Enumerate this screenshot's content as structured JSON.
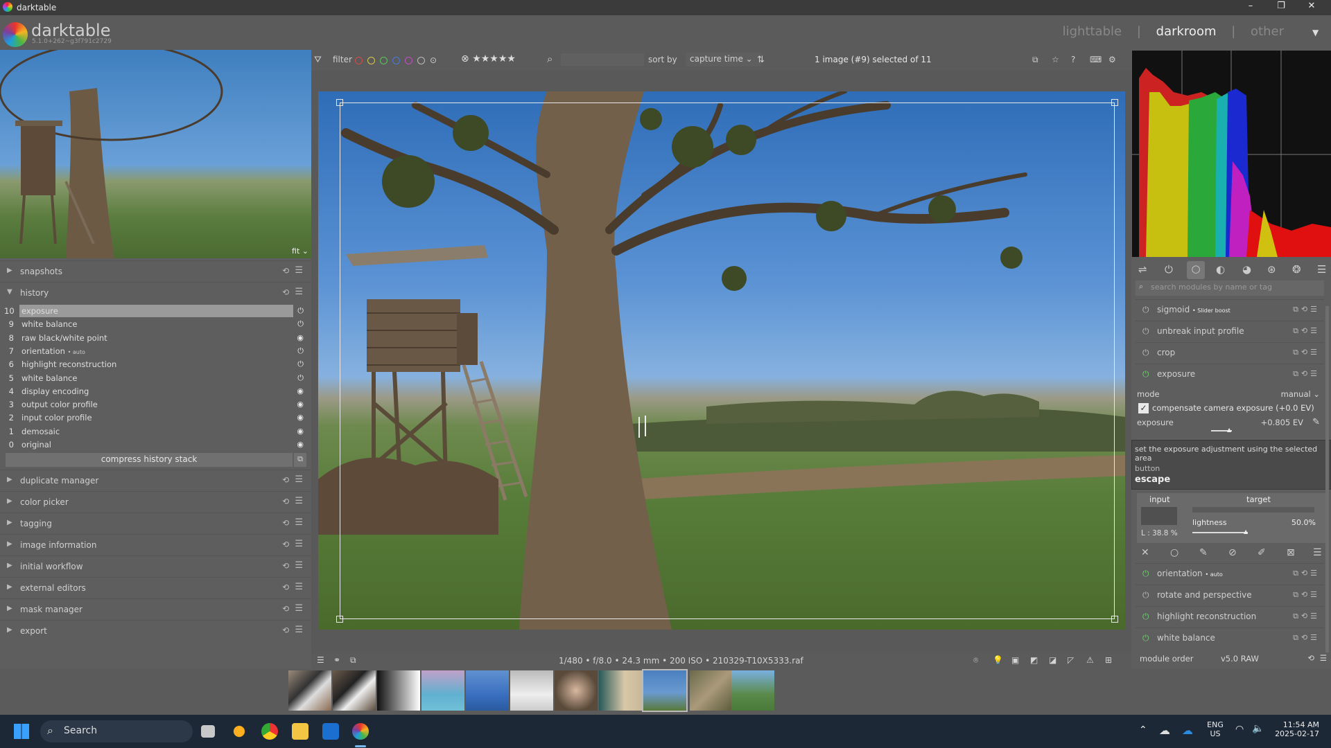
{
  "window": {
    "title": "darktable",
    "minimize": "–",
    "restore": "❐",
    "close": "✕"
  },
  "app": {
    "name": "darktable",
    "version": "5.1.0+262~g3f791c2729"
  },
  "views": {
    "lighttable": "lighttable",
    "sep1": "|",
    "darkroom": "darkroom",
    "sep2": "|",
    "other": "other",
    "active": "darkroom"
  },
  "navigation": {
    "zoom": "fit"
  },
  "left_modules": {
    "snapshots": "snapshots",
    "history": "history",
    "duplicate_manager": "duplicate manager",
    "color_picker": "color picker",
    "tagging": "tagging",
    "image_information": "image information",
    "initial_workflow": "initial workflow",
    "external_editors": "external editors",
    "mask_manager": "mask manager",
    "export": "export"
  },
  "history": {
    "items": [
      {
        "num": "10",
        "name": "exposure",
        "auto": ""
      },
      {
        "num": "9",
        "name": "white balance",
        "auto": ""
      },
      {
        "num": "8",
        "name": "raw black/white point",
        "auto": ""
      },
      {
        "num": "7",
        "name": "orientation",
        "auto": "• auto"
      },
      {
        "num": "6",
        "name": "highlight reconstruction",
        "auto": ""
      },
      {
        "num": "5",
        "name": "white balance",
        "auto": ""
      },
      {
        "num": "4",
        "name": "display encoding",
        "auto": ""
      },
      {
        "num": "3",
        "name": "output color profile",
        "auto": ""
      },
      {
        "num": "2",
        "name": "input color profile",
        "auto": ""
      },
      {
        "num": "1",
        "name": "demosaic",
        "auto": ""
      },
      {
        "num": "0",
        "name": "original",
        "auto": ""
      }
    ],
    "compress_label": "compress history stack"
  },
  "topbar": {
    "filter_label": "filter",
    "sort_label": "sort by",
    "sort_value": "capture time",
    "selection_info": "1 image (#9) selected of 11",
    "color_labels": [
      "#d84a4a",
      "#d8c84a",
      "#5ac85a",
      "#4a7ad8",
      "#c84ac8",
      "#bbbbbb"
    ],
    "rating": "★★★★★"
  },
  "image_info": "1/480 • f/8.0 • 24.3 mm • 200 ISO • 210329-T10X5333.raf",
  "right_panel": {
    "search_placeholder": "search modules by name or tag",
    "modules": {
      "sigmoid": "sigmoid",
      "sigmoid_tag": "• Slider boost",
      "unbreak": "unbreak input profile",
      "crop": "crop",
      "exposure": "exposure",
      "orientation": "orientation",
      "orientation_tag": "• auto",
      "rotate": "rotate and perspective",
      "highlight": "highlight reconstruction",
      "white_balance": "white balance"
    },
    "exposure_panel": {
      "mode_label": "mode",
      "mode_value": "manual",
      "compensate_label": "compensate camera exposure (+0.0 EV)",
      "exposure_label": "exposure",
      "exposure_value": "+0.805 EV"
    },
    "tooltip": {
      "description": "set the exposure adjustment using the selected area",
      "button_label": "button",
      "button_value": "escape"
    },
    "spot": {
      "input_label": "input",
      "target_label": "target",
      "input_value": "L : 38.8 %",
      "lightness_label": "lightness",
      "lightness_value": "50.0%"
    },
    "module_order_label": "module order",
    "module_order_value": "v5.0 RAW"
  },
  "taskbar": {
    "search_placeholder": "Search",
    "lang": "ENG",
    "region": "US",
    "time": "11:54 AM",
    "date": "2025-02-17"
  }
}
